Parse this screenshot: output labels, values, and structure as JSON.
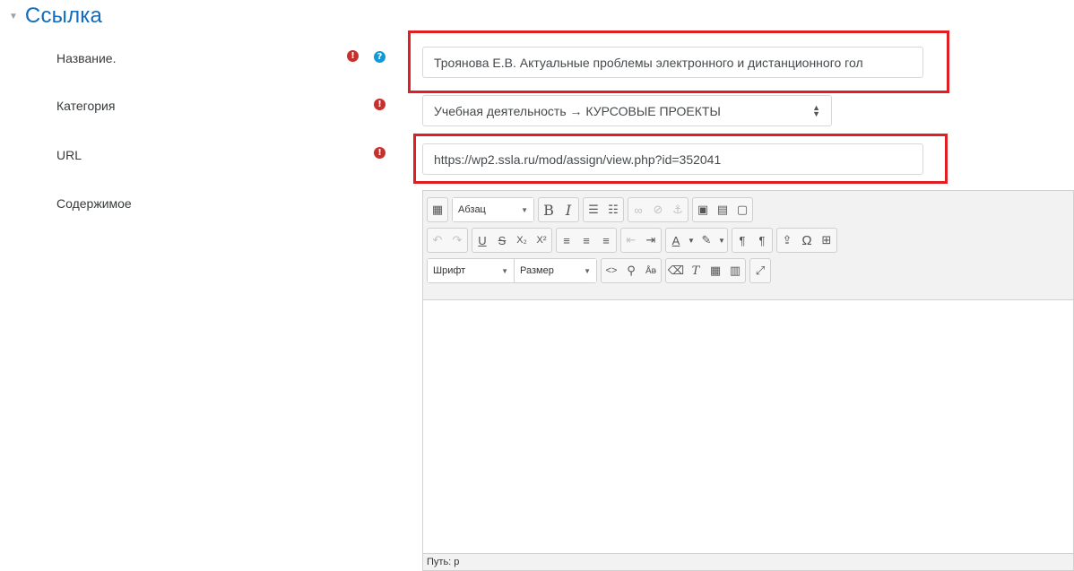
{
  "section": {
    "title": "Ссылка"
  },
  "fields": {
    "name": {
      "label": "Название.",
      "value": "Троянова Е.В. Актуальные проблемы электронного и дистанционного гол"
    },
    "category": {
      "label": "Категория",
      "value": "Учебная деятельность → КУРСОВЫЕ ПРОЕКТЫ"
    },
    "url": {
      "label": "URL",
      "value": "https://wp2.ssla.ru/mod/assign/view.php?id=352041"
    },
    "content": {
      "label": "Содержимое"
    }
  },
  "editor": {
    "format_label": "Абзац",
    "font_label": "Шрифт",
    "size_label": "Размер",
    "status_text": "Путь: p"
  },
  "icons": {
    "required": "!",
    "help": "?",
    "bold": "B",
    "italic": "I",
    "underline": "U",
    "strike": "S",
    "subscript": "X₂",
    "superscript": "X²",
    "omega": "Ω",
    "code": "<>",
    "ltr": "¶",
    "rtl": "¶"
  },
  "colors": {
    "accent": "#0f6cbf",
    "required": "#c9302c",
    "help": "#0f9ad7",
    "highlight": "#e01f25"
  }
}
